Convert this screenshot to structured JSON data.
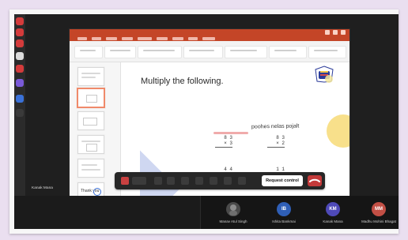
{
  "app": {
    "ppt_window_title": "",
    "slide": {
      "heading": "Multiply the following.",
      "handwriting": "poohes nelas pojalt",
      "problems": [
        {
          "top": "8 3",
          "bottom": "× 3"
        },
        {
          "top": "8 3",
          "bottom": "× 2"
        },
        {
          "top": "4 4",
          "bottom": "× 2"
        },
        {
          "top": "1 1",
          "bottom": "× 9"
        }
      ]
    },
    "thumb_text": "Thank you"
  },
  "meeting": {
    "presenter_label": "Kanak Mana",
    "controls": {
      "request_control_label": "Request control"
    },
    "participants": [
      {
        "name": "Manav Atul Singh",
        "initials": "",
        "avatar_style": "photo"
      },
      {
        "name": "Ishita Bankmai",
        "initials": "IB",
        "avatar_style": "blue"
      },
      {
        "name": "Kanak Mana",
        "initials": "KM",
        "avatar_style": "purple"
      },
      {
        "name": "Madhu Mohini Bhagat",
        "initials": "MM",
        "avatar_style": "red"
      }
    ]
  },
  "colors": {
    "background": "#eadff0",
    "meeting_dark": "#1f1f1f",
    "ppt_accent": "#c44527",
    "control_end": "#c43a3a"
  }
}
